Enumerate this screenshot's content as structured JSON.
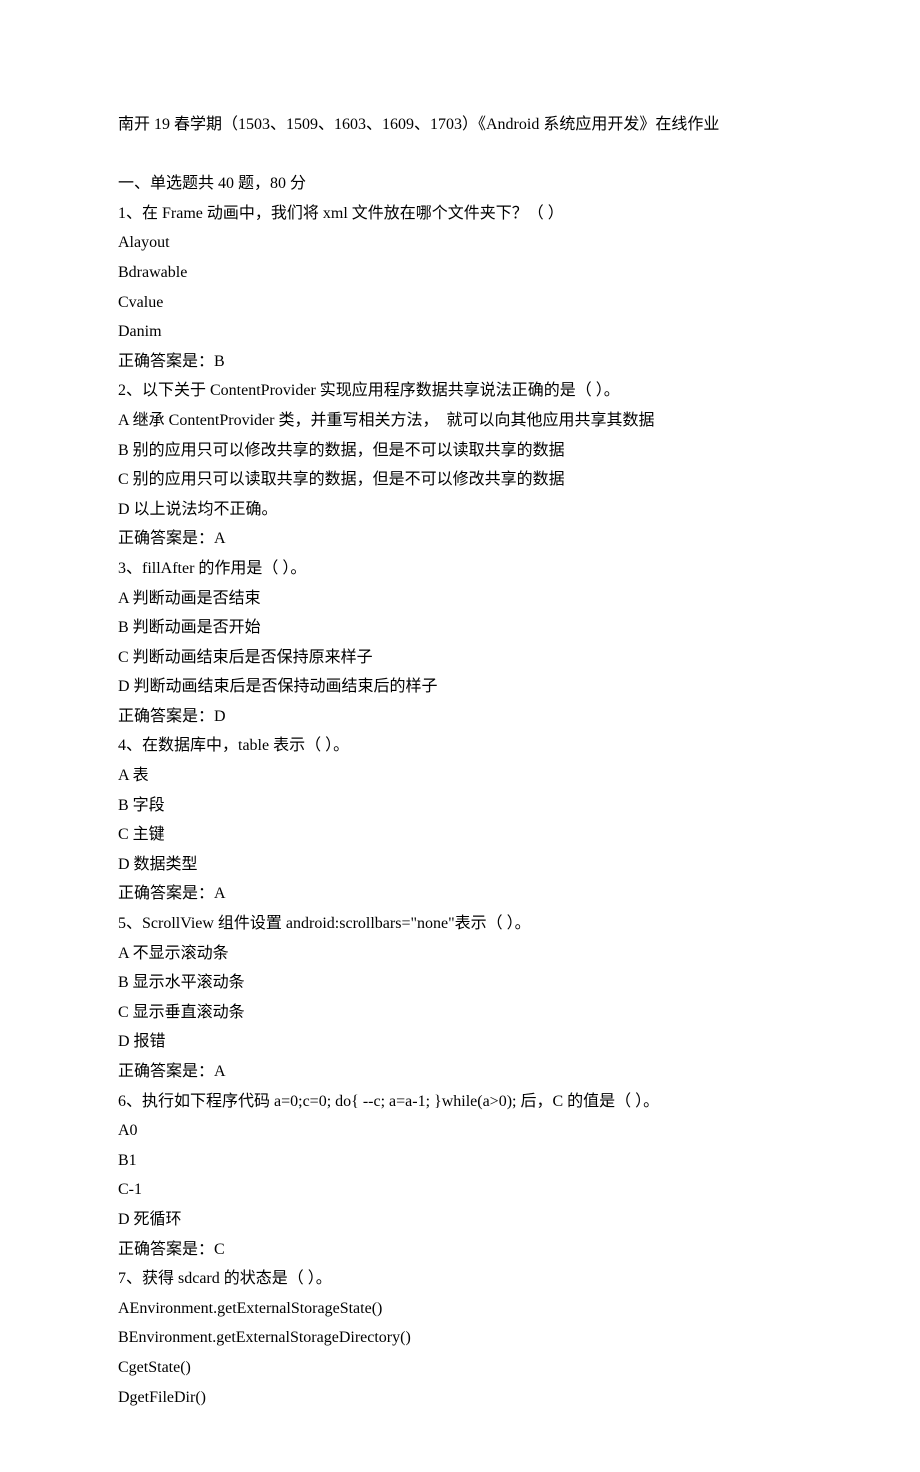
{
  "title": "南开 19 春学期（1503、1509、1603、1609、1703）《Android 系统应用开发》在线作业",
  "section_header": "一、单选题共 40 题，80 分",
  "questions": [
    {
      "stem": "1、在 Frame 动画中，我们将 xml 文件放在哪个文件夹下？（ ）",
      "options": [
        "Alayout",
        "Bdrawable",
        "Cvalue",
        "Danim"
      ],
      "answer": "正确答案是：B"
    },
    {
      "stem": "2、以下关于 ContentProvider 实现应用程序数据共享说法正确的是（ ）。",
      "options": [
        "A 继承 ContentProvider 类，并重写相关方法，  就可以向其他应用共享其数据",
        "B 别的应用只可以修改共享的数据，但是不可以读取共享的数据",
        "C 别的应用只可以读取共享的数据，但是不可以修改共享的数据",
        "D 以上说法均不正确。"
      ],
      "answer": "正确答案是：A"
    },
    {
      "stem": "3、fillAfter 的作用是（ ）。",
      "options": [
        "A 判断动画是否结束",
        "B 判断动画是否开始",
        "C 判断动画结束后是否保持原来样子",
        "D 判断动画结束后是否保持动画结束后的样子"
      ],
      "answer": "正确答案是：D"
    },
    {
      "stem": "4、在数据库中，table 表示（ ）。",
      "options": [
        "A 表",
        "B 字段",
        "C 主键",
        "D 数据类型"
      ],
      "answer": "正确答案是：A"
    },
    {
      "stem": "5、ScrollView 组件设置 android:scrollbars=\"none\"表示（ ）。",
      "options": [
        "A 不显示滚动条",
        "B 显示水平滚动条",
        "C 显示垂直滚动条",
        "D 报错"
      ],
      "answer": "正确答案是：A"
    },
    {
      "stem": "6、执行如下程序代码 a=0;c=0; do{ --c; a=a-1; }while(a>0); 后，C 的值是（ ）。",
      "options": [
        "A0",
        "B1",
        "C-1",
        "D 死循环"
      ],
      "answer": "正确答案是：C"
    },
    {
      "stem": "7、获得 sdcard 的状态是（ ）。",
      "options": [
        "AEnvironment.getExternalStorageState()",
        "BEnvironment.getExternalStorageDirectory()",
        "CgetState()",
        "DgetFileDir()"
      ],
      "answer": ""
    }
  ]
}
